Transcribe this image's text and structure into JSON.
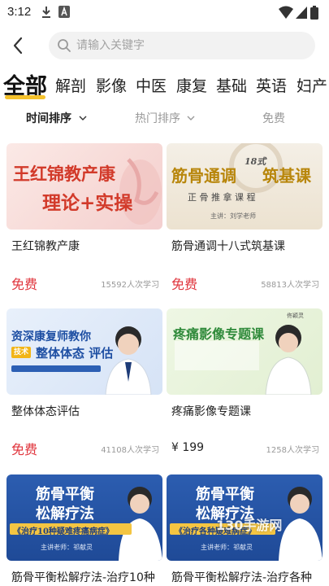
{
  "status": {
    "time": "3:12"
  },
  "search": {
    "placeholder": "请输入关键字"
  },
  "categories": [
    "全部",
    "解剖",
    "影像",
    "中医",
    "康复",
    "基础",
    "英语",
    "妇产"
  ],
  "sort": {
    "time_label": "时间排序",
    "hot_label": "热门排序",
    "free_label": "免费"
  },
  "courses": [
    {
      "title": "王红锦教产康",
      "price": "免费",
      "learners": "15592人次学习",
      "thumb_line1": "王红锦教产康",
      "thumb_line2": "理论+实操"
    },
    {
      "title": "筋骨通调十八式筑基课",
      "price": "免费",
      "learners": "58813人次学习",
      "thumb_line1": "筋骨通调",
      "thumb_badge": "18式",
      "thumb_line1b": "筑基课",
      "thumb_sub": "正 骨 推 拿 课 程",
      "thumb_teacher": "主讲：刘学老师"
    },
    {
      "title": "整体体态评估",
      "price": "免费",
      "learners": "41108人次学习",
      "thumb_line1": "资深康复师教你",
      "thumb_tag": "技术",
      "thumb_line2": "整体体态 评估"
    },
    {
      "title": "疼痛影像专题课",
      "price": "¥ 199",
      "learners": "1258人次学习",
      "thumb_line1": "疼痛影像专题课",
      "thumb_name": "佟颖灵"
    },
    {
      "title": "筋骨平衡松解疗法-治疗10种",
      "thumb_line1": "筋骨平衡",
      "thumb_line2": "松解疗法",
      "thumb_banner": "《治疗10种疑难疼痛病症》",
      "thumb_teacher": "主讲老师：祁献灵"
    },
    {
      "title": "筋骨平衡松解疗法-治疗各种",
      "thumb_line1": "筋骨平衡",
      "thumb_line2": "松解疗法",
      "thumb_banner": "《治疗各种疑难病症》",
      "thumb_teacher": "主讲老师：祁献灵"
    }
  ],
  "watermark": "130手游网",
  "colors": {
    "accent_underline": "#f5c22c",
    "free_price": "#e0343c",
    "search_bg": "#f2f2f2"
  }
}
